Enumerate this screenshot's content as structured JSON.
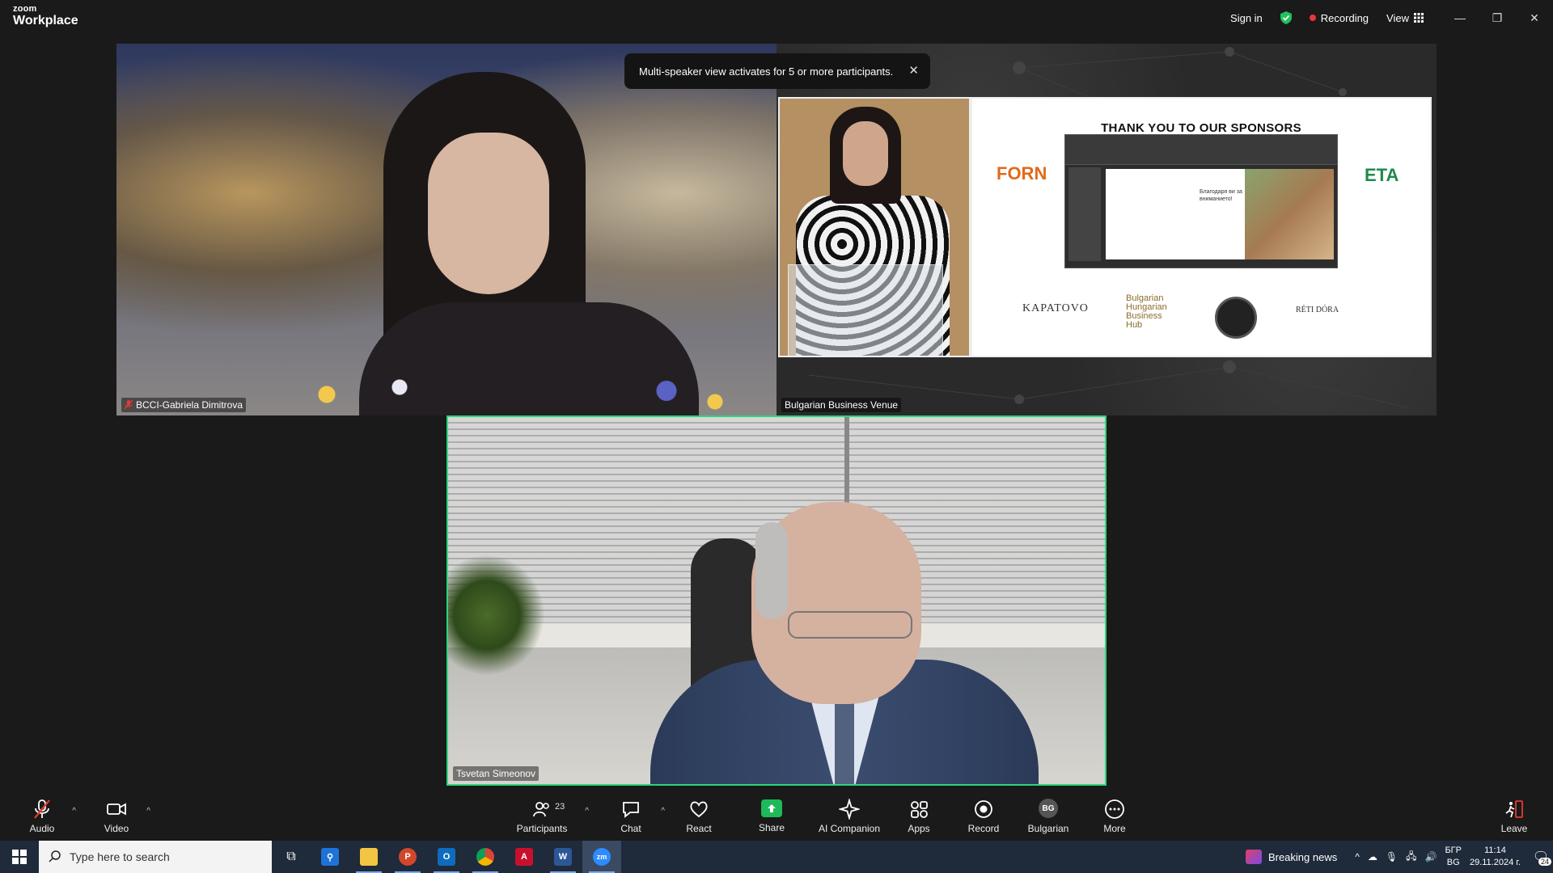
{
  "titlebar": {
    "brand_small": "zoom",
    "brand_large": "Workplace",
    "sign_in": "Sign in",
    "recording": "Recording",
    "view": "View"
  },
  "toast": {
    "message": "Multi-speaker view activates for 5 or more participants."
  },
  "tiles": {
    "gabriela": {
      "name": "BCCI-Gabriela Dimitrova"
    },
    "venue": {
      "name": "Bulgarian Business Venue",
      "slide_title": "THANK YOU TO OUR SPONSORS",
      "sponsors": {
        "forn": "FORN",
        "eta": "ETA",
        "karatovo": "KAPATOVO",
        "bhbh": [
          "Bulgarian",
          "Hungarian",
          "Business",
          "Hub"
        ],
        "reti": "RÉTI DÓRA"
      },
      "inner_slide_text": "Благодаря ви за вниманието!"
    },
    "tsvetan": {
      "name": "Tsvetan Simeonov"
    }
  },
  "controls": {
    "audio": "Audio",
    "video": "Video",
    "participants": "Participants",
    "participants_count": "23",
    "chat": "Chat",
    "react": "React",
    "share": "Share",
    "ai_companion": "AI Companion",
    "apps": "Apps",
    "record": "Record",
    "language": "Bulgarian",
    "language_initials": "BG",
    "more": "More",
    "leave": "Leave"
  },
  "taskbar": {
    "search_placeholder": "Type here to search",
    "news": "Breaking news",
    "keyboard_lang_top": "БГР",
    "keyboard_lang_bottom": "BG",
    "time": "11:14",
    "date": "29.11.2024 г.",
    "notifications": "24"
  },
  "colors": {
    "active_speaker_border": "#2bd67b",
    "recording_dot": "#e53935",
    "share_green": "#1fb959"
  }
}
